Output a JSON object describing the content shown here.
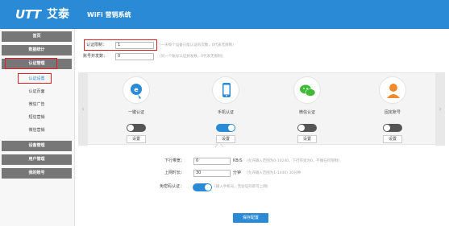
{
  "header": {
    "logo": "UTT",
    "brand": "艾泰",
    "title": "WiFi 营销系统"
  },
  "sidebar": {
    "items": [
      {
        "label": "首页"
      },
      {
        "label": "数据统计"
      },
      {
        "label": "认证管理"
      },
      {
        "label": "认证设置"
      },
      {
        "label": "认证页面"
      },
      {
        "label": "微信广告"
      },
      {
        "label": "短信营销"
      },
      {
        "label": "微信营销"
      },
      {
        "label": "设备管理"
      },
      {
        "label": "用户管理"
      },
      {
        "label": "我的账号"
      }
    ]
  },
  "form_top": {
    "auth_limit_label": "认证限制：",
    "auth_limit_value": "1",
    "auth_limit_hint": "(一天每个设备只能认证的次数，0代表无限制)",
    "account_count_label": "账号并发数：",
    "account_count_value": "0",
    "account_count_hint": "(同一个账号认证并发数，0代表无限制)"
  },
  "auth_methods": [
    {
      "label": "一键认证",
      "icon": "one-click-icon",
      "enabled": false,
      "button": "设置"
    },
    {
      "label": "手机认证",
      "icon": "phone-icon",
      "enabled": true,
      "button": "设置"
    },
    {
      "label": "微信认证",
      "icon": "wechat-icon",
      "enabled": false,
      "button": "设置"
    },
    {
      "label": "固定账号",
      "icon": "user-icon",
      "enabled": false,
      "button": "设置"
    }
  ],
  "form_bottom": {
    "bandwidth_label": "下行带宽：",
    "bandwidth_value": "0",
    "bandwidth_unit": "KB/S",
    "bandwidth_hint": "(允许输入范围为0-10240，下行带宽为0，不做任何限制)",
    "duration_label": "上网时长：",
    "duration_value": "30",
    "duration_unit": "分钟",
    "duration_hint": "(允许输入范围为1-1440)  30分钟",
    "exempt_label": "免密码认证：",
    "exempt_enabled": true,
    "exempt_hint": "(输入手机号，无验证码即可上网)"
  },
  "save_button": "保存配置",
  "colors": {
    "accent": "#2b8ad6",
    "menu_gray": "#777777",
    "highlight_red": "#e02020",
    "wechat_green": "#3fb838",
    "user_orange": "#f08a2a"
  }
}
